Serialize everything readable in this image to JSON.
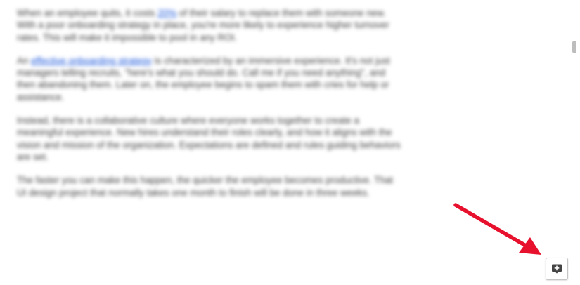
{
  "document": {
    "paragraphs": [
      {
        "segments": [
          {
            "text": "When an employee quits, it costs ",
            "link": false
          },
          {
            "text": "20%",
            "link": true
          },
          {
            "text": " of their salary to replace them with someone new. With a poor onboarding strategy in place, you're more likely to experience higher turnover rates. This will make it impossible to pool in any ROI.",
            "link": false
          }
        ]
      },
      {
        "segments": [
          {
            "text": "An ",
            "link": false
          },
          {
            "text": "effective onboarding strategy",
            "link": true
          },
          {
            "text": " is characterized by an immersive experience. It's not just managers telling recruits, \"here's what you should do. Call me if you need anything\", and then abandoning them. Later on, the employee begins to spam them with cries for help or assistance.",
            "link": false
          }
        ]
      },
      {
        "segments": [
          {
            "text": "Instead, there is a collaborative culture where everyone works together to create a meaningful experience. New hires understand their roles clearly, and how it aligns with the vision and mission of the organization. Expectations are defined and rules guiding behaviors are set.",
            "link": false
          }
        ]
      },
      {
        "segments": [
          {
            "text": "The faster you can make this happen, the quicker the employee becomes productive. That UI design project that normally takes one month to finish will be done in three weeks.",
            "link": false
          }
        ]
      }
    ]
  },
  "side_panel": {
    "add_comment_icon": "add-comment-icon"
  },
  "annotation": {
    "arrow_color": "#e8112d"
  },
  "colors": {
    "link": "#1a56db",
    "text": "#3c3c3c"
  }
}
